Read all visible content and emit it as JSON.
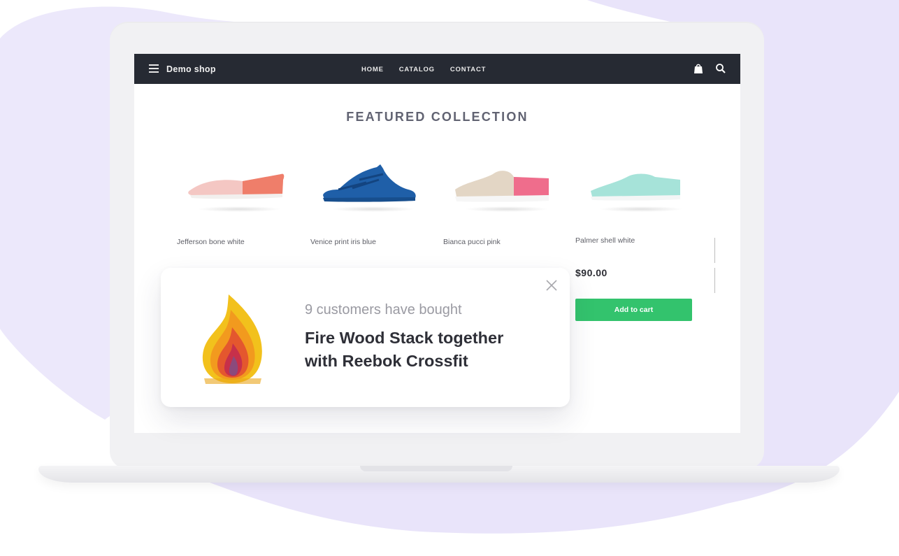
{
  "colors": {
    "background_blob": "#e9e4fa",
    "navbar": "#262a33",
    "accent_green": "#33c36d",
    "heading": "#616372"
  },
  "header": {
    "brand": "Demo shop",
    "menu_icon": "hamburger-menu-icon",
    "nav": [
      "HOME",
      "CATALOG",
      "CONTACT"
    ],
    "icons": [
      "shopping-bag-icon",
      "search-icon"
    ]
  },
  "main": {
    "section_title": "FEATURED COLLECTION",
    "products": [
      {
        "name": "Jefferson bone  white",
        "image": "shoe-pink-coral"
      },
      {
        "name": "Venice print iris blue",
        "image": "sandal-blue"
      },
      {
        "name": "Bianca pucci pink",
        "image": "shoe-beige-pink"
      },
      {
        "name": "Palmer shell white",
        "image": "shoe-mint"
      }
    ],
    "price": "$90.00",
    "add_to_cart": "Add to cart"
  },
  "popup": {
    "subtitle": "9 customers have bought",
    "title": "Fire Wood Stack together with Reebok Crossfit",
    "image": "fire-wood-stack-icon",
    "close_icon": "close-icon"
  }
}
